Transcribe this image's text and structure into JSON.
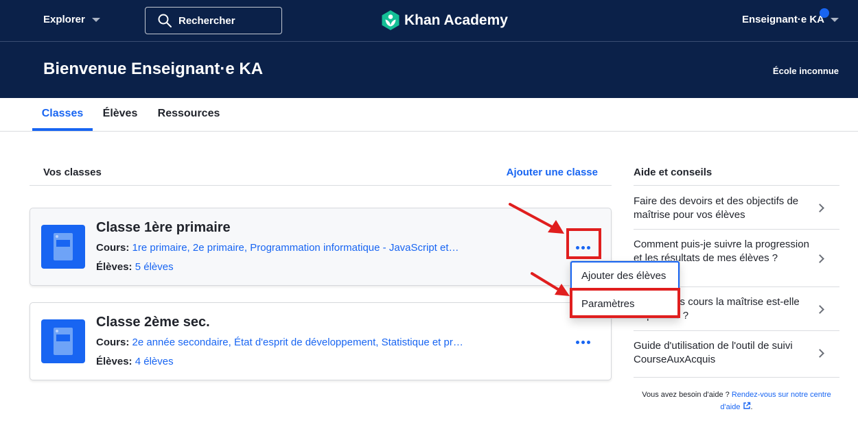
{
  "nav": {
    "explore_label": "Explorer",
    "search_label": "Rechercher",
    "logo_text": "Khan Academy",
    "user_label": "Enseignant·e KA"
  },
  "banner": {
    "title": "Bienvenue Enseignant·e KA",
    "school": "École inconnue"
  },
  "tabs": [
    {
      "label": "Classes",
      "active": true
    },
    {
      "label": "Élèves",
      "active": false
    },
    {
      "label": "Ressources",
      "active": false
    }
  ],
  "classes_section": {
    "title": "Vos classes",
    "add_label": "Ajouter une classe",
    "courses_label": "Cours:",
    "students_label": "Élèves:",
    "items": [
      {
        "name": "Classe 1ère primaire",
        "courses": "1re primaire, 2e primaire, Programmation informatique - JavaScript et…",
        "students": "5 élèves"
      },
      {
        "name": "Classe 2ème sec.",
        "courses": "2e année secondaire, État d'esprit de développement, Statistique et pr…",
        "students": "4 élèves"
      }
    ]
  },
  "class_menu": {
    "items": [
      "Ajouter des élèves",
      "Paramètres"
    ]
  },
  "aside": {
    "title": "Aide et conseils",
    "items": [
      "Faire des devoirs et des objectifs de maîtrise pour vos élèves",
      "Comment puis-je suivre la progression et les résultats de mes élèves ?",
      "Dans quels cours la maîtrise est-elle disponible ?",
      "Guide d'utilisation de l'outil de suivi CourseAuxAcquis"
    ],
    "help_prefix": "Vous avez besoin d'aide ?",
    "help_link": "Rendez-vous sur notre centre d'aide"
  },
  "colors": {
    "navy": "#0b2149",
    "blue": "#1865f2",
    "annotation_red": "#e01e1e",
    "logo_green": "#14bf96"
  }
}
